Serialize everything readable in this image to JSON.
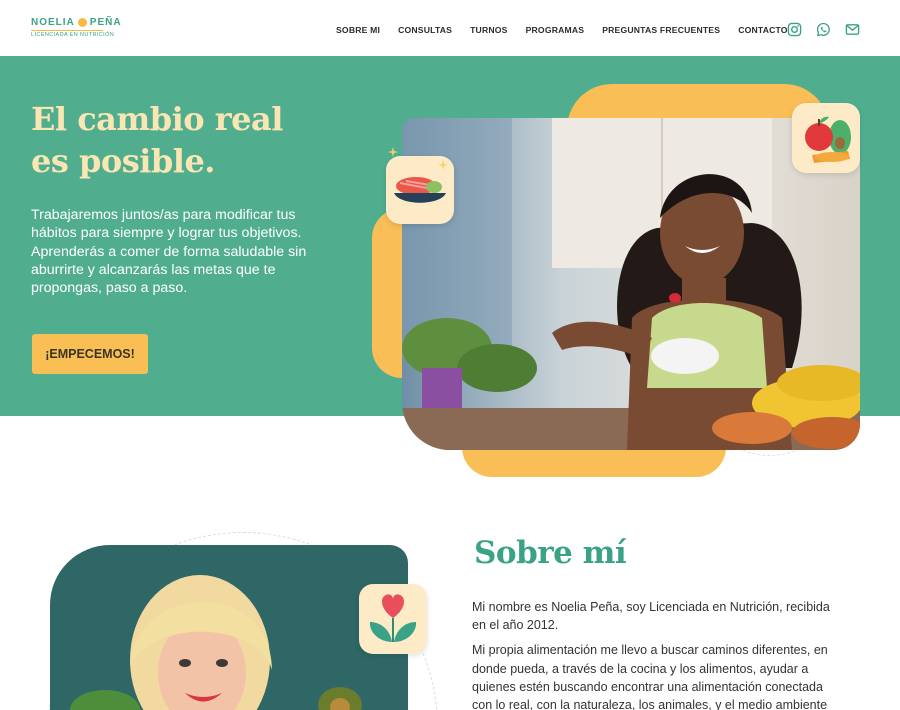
{
  "brand": {
    "name_first": "NOELIA",
    "name_last": "PEÑA",
    "subtitle": "LICENCIADA EN NUTRICIÓN"
  },
  "nav": {
    "items": [
      {
        "label": "SOBRE MI"
      },
      {
        "label": "CONSULTAS"
      },
      {
        "label": "TURNOS"
      },
      {
        "label": "PROGRAMAS"
      },
      {
        "label": "PREGUNTAS FRECUENTES"
      },
      {
        "label": "CONTACTO"
      }
    ]
  },
  "social": [
    "instagram-icon",
    "whatsapp-icon",
    "mail-icon"
  ],
  "hero": {
    "title_line1": "El cambio real",
    "title_line2": "es posible.",
    "text": "Trabajaremos juntos/as para modificar tus hábitos para siempre y lograr tus objetivos. Aprenderás a comer de forma saludable sin aburrirte y alcanzarás las metas que te propongas, paso a paso.",
    "cta_label": "¡EMPECEMOS!"
  },
  "about": {
    "title": "Sobre mí",
    "paragraph1": "Mi nombre es Noelia Peña, soy Licenciada en Nutrición, recibida en el año 2012.",
    "paragraph2": "Mi propia alimentación me llevo a buscar caminos diferentes, en donde pueda, a través de la cocina y los alimentos, ayudar a quienes estén buscando encontrar una alimentación conectada con lo real, con la naturaleza, los animales, y el medio ambiente"
  },
  "colors": {
    "green": "#50ae8f",
    "brand_green": "#3aa287",
    "yellow": "#f9be56",
    "cream": "#fbe6b3"
  }
}
